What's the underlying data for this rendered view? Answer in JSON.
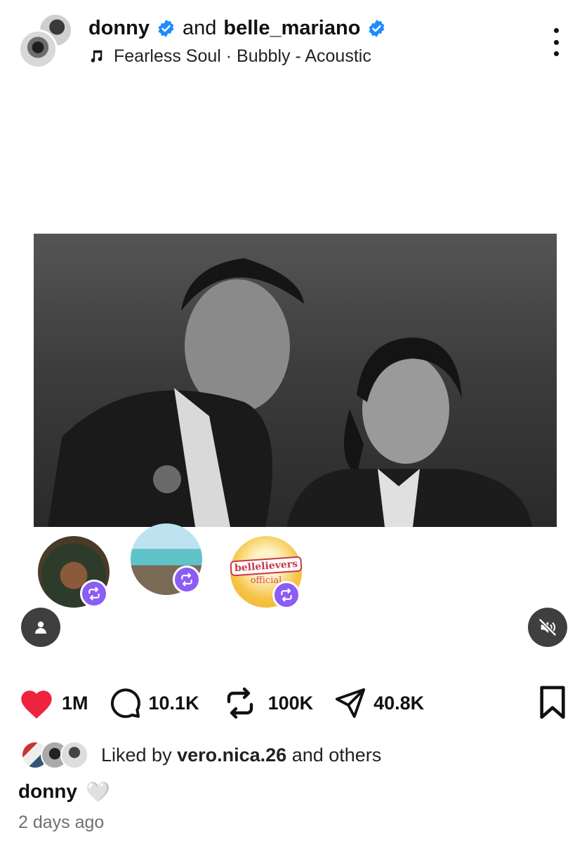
{
  "post": {
    "author1": "donny",
    "connector": "and",
    "author2": "belle_mariano",
    "audio": "Fearless Soul · Bubbly - Acoustic"
  },
  "media": {
    "description_icon": "photo-still"
  },
  "reposters": [
    {
      "name": "reposter-1"
    },
    {
      "name": "reposter-2"
    },
    {
      "name": "bellelievers-logo",
      "logo_text": "bellelievers",
      "logo_sub": "official"
    }
  ],
  "actions": {
    "likes": "1M",
    "comments": "10.1K",
    "reposts": "100K",
    "shares": "40.8K"
  },
  "liked_by": {
    "prefix": "Liked by",
    "user": "vero.nica.26",
    "suffix": "and others"
  },
  "caption": {
    "user": "donny",
    "emoji": "🤍"
  },
  "timestamp": "2 days ago",
  "colors": {
    "verified": "#1a8cff",
    "like": "#ed2440",
    "repost_badge": "#8b5cf6"
  }
}
